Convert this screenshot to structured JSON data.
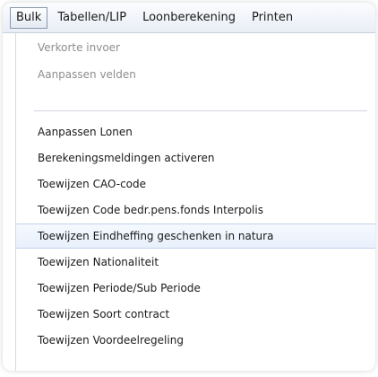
{
  "menubar": {
    "items": [
      {
        "label": "Bulk"
      },
      {
        "label": "Tabellen/LIP"
      },
      {
        "label": "Loonberekening"
      },
      {
        "label": "Printen"
      }
    ]
  },
  "dropdown": {
    "disabled_items": [
      {
        "label": "Verkorte invoer"
      },
      {
        "label": "Aanpassen velden"
      }
    ],
    "items": [
      {
        "label": "Aanpassen Lonen"
      },
      {
        "label": "Berekeningsmeldingen activeren"
      },
      {
        "label": "Toewijzen CAO-code"
      },
      {
        "label": "Toewijzen Code bedr.pens.fonds Interpolis"
      },
      {
        "label": "Toewijzen Eindheffing geschenken in natura"
      },
      {
        "label": "Toewijzen Nationaliteit"
      },
      {
        "label": "Toewijzen Periode/Sub Periode"
      },
      {
        "label": "Toewijzen Soort contract"
      },
      {
        "label": "Toewijzen Voordeelregeling"
      }
    ]
  }
}
